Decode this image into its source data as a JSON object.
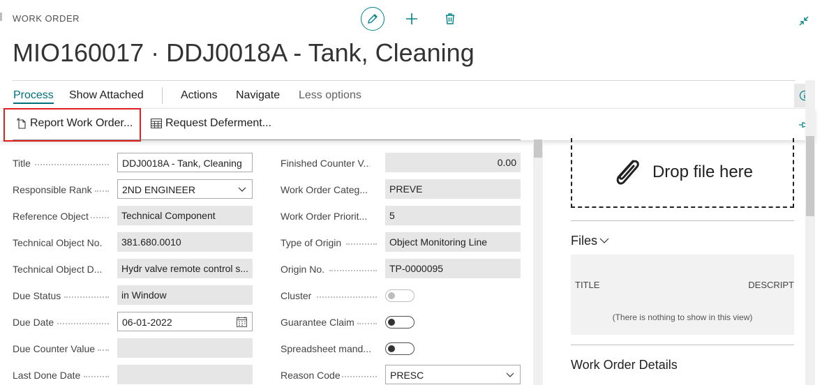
{
  "header": {
    "kicker": "WORK ORDER",
    "title": "MIO160017 · DDJ0018A - Tank, Cleaning"
  },
  "tabs": [
    {
      "label": "Process"
    },
    {
      "label": "Show Attached"
    },
    {
      "label": "Actions"
    },
    {
      "label": "Navigate"
    },
    {
      "label": "Less options"
    }
  ],
  "actions": {
    "report": "Report Work Order...",
    "request": "Request Deferment..."
  },
  "left_fields": [
    {
      "label": "Title",
      "value": "DDJ0018A - Tank, Cleaning"
    },
    {
      "label": "Responsible Rank",
      "value": "2ND ENGINEER"
    },
    {
      "label": "Reference Object",
      "value": "Technical Component"
    },
    {
      "label": "Technical Object No.",
      "value": "381.680.0010"
    },
    {
      "label": "Technical Object D...",
      "value": "Hydr valve remote control s..."
    },
    {
      "label": "Due Status",
      "value": "in Window"
    },
    {
      "label": "Due Date",
      "value": "06-01-2022"
    },
    {
      "label": "Due Counter Value",
      "value": ""
    },
    {
      "label": "Last Done Date",
      "value": ""
    }
  ],
  "right_fields": [
    {
      "label": "Finished Counter V...",
      "value": "0.00"
    },
    {
      "label": "Work Order Categ...",
      "value": "PREVE"
    },
    {
      "label": "Work Order Priorit...",
      "value": "5"
    },
    {
      "label": "Type of Origin",
      "value": "Object Monitoring Line"
    },
    {
      "label": "Origin No.",
      "value": "TP-0000095"
    },
    {
      "label": "Cluster",
      "value": "off",
      "toggle": true,
      "disabled": true
    },
    {
      "label": "Guarantee Claim",
      "value": "off",
      "toggle": true
    },
    {
      "label": "Spreadsheet mand...",
      "value": "off",
      "toggle": true
    },
    {
      "label": "Reason Code",
      "value": "PRESC"
    }
  ],
  "factbox": {
    "drop_text": "Drop file here",
    "files_title": "Files",
    "col_title": "TITLE",
    "col_desc": "DESCRIPT",
    "empty": "(There is nothing to show in this view)",
    "details_title": "Work Order Details"
  },
  "colors": {
    "accent": "#00707a",
    "highlight": "#e02020"
  }
}
